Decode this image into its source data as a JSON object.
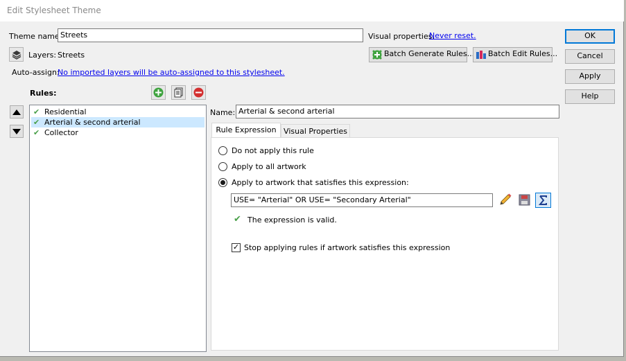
{
  "window": {
    "title": "Edit Stylesheet Theme"
  },
  "theme": {
    "name_label": "Theme name:",
    "name_value": "Streets"
  },
  "visual_properties": {
    "label": "Visual properties:",
    "link": "Never reset."
  },
  "layers": {
    "label": "Layers:",
    "value": "Streets"
  },
  "batch": {
    "generate_label": "Batch Generate Rules...",
    "edit_label": "Batch Edit Rules..."
  },
  "auto_assign": {
    "label": "Auto-assign:",
    "link": "No imported layers will be auto-assigned to this stylesheet."
  },
  "rules": {
    "label": "Rules:",
    "items": [
      {
        "label": "Residential",
        "checked": true
      },
      {
        "label": "Arterial & second arterial",
        "checked": true,
        "selected": true
      },
      {
        "label": "Collector",
        "checked": true
      }
    ]
  },
  "rule_detail": {
    "name_label": "Name:",
    "name_value": "Arterial & second arterial",
    "tabs": [
      {
        "label": "Rule Expression"
      },
      {
        "label": "Visual Properties"
      }
    ],
    "options": {
      "none": "Do not apply this rule",
      "all": "Apply to all artwork",
      "expression": "Apply to artwork that satisfies this expression:"
    },
    "expression_value": "USE= \"Arterial\" OR USE= \"Secondary Arterial\"",
    "validity_message": "The expression is valid.",
    "stop_label": "Stop applying rules if artwork satisfies this expression"
  },
  "buttons": {
    "ok": "OK",
    "cancel": "Cancel",
    "apply": "Apply",
    "help": "Help"
  },
  "colors": {
    "accent": "#0078d7",
    "check_green": "#4aa04a",
    "link": "#0000ee",
    "selection": "#cce8ff"
  }
}
